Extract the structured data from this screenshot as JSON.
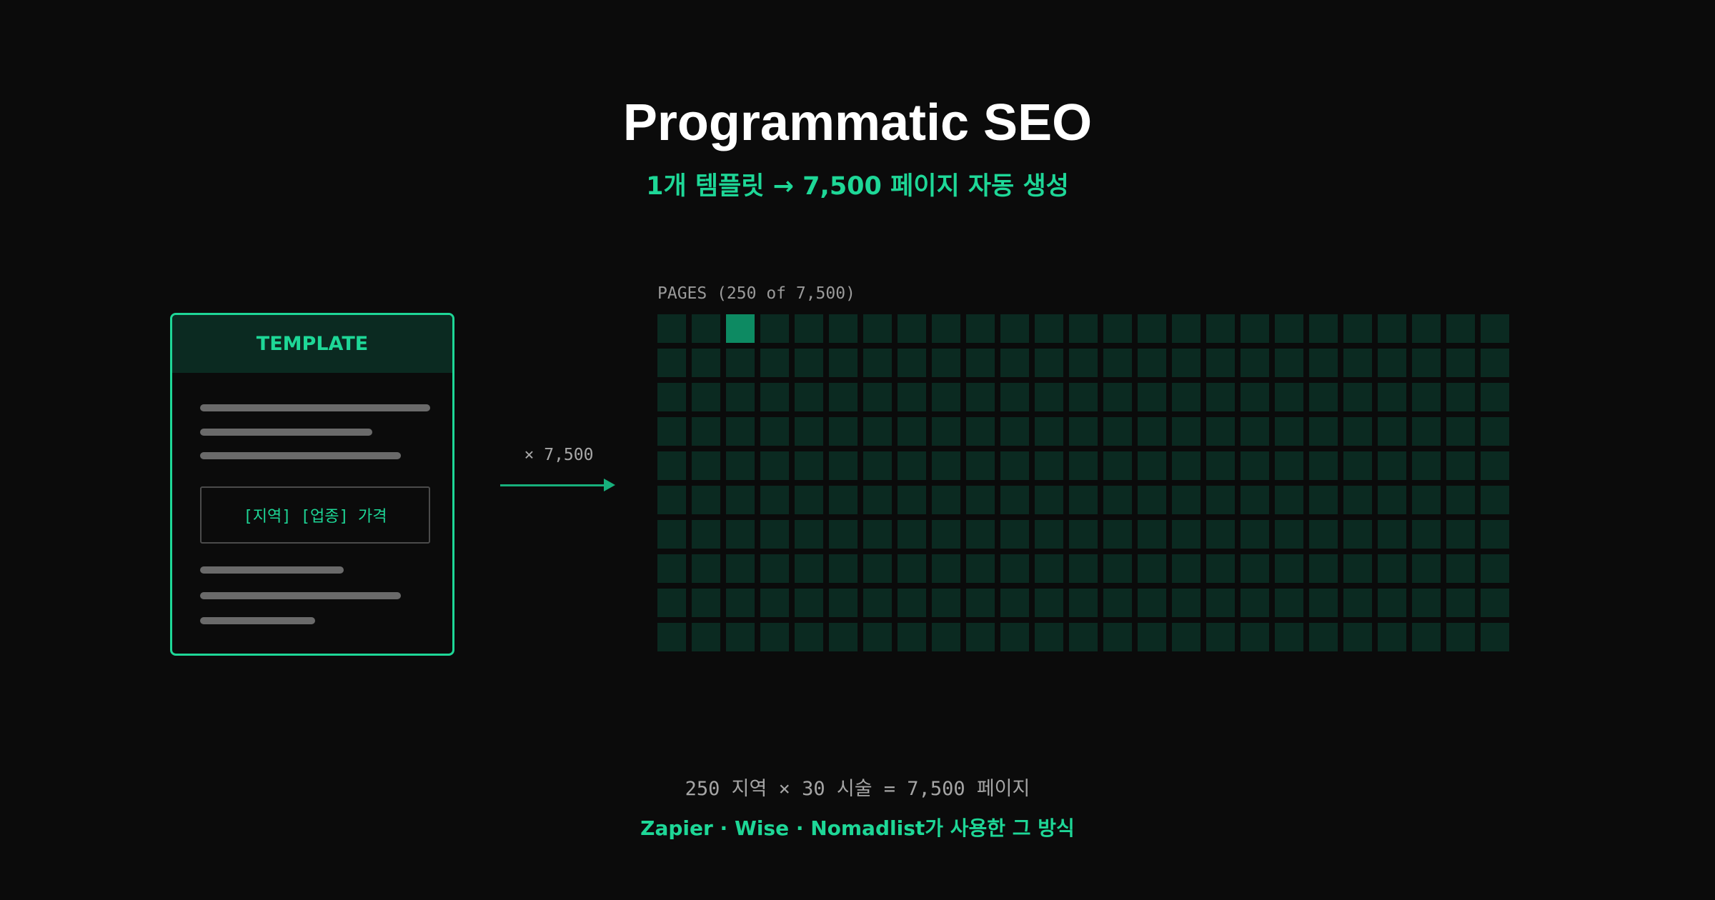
{
  "title": "Programmatic SEO",
  "subtitle": "1개 템플릿 → 7,500 페이지 자동 생성",
  "template": {
    "header": "TEMPLATE",
    "placeholder": "[지역] [업종] 가격"
  },
  "multiplier": "× 7,500",
  "pages": {
    "label": "PAGES (250 of 7,500)",
    "highlight_index": 2
  },
  "formula": "250 지역 × 30 시술 = 7,500 페이지",
  "footnote": "Zapier · Wise · Nomadlist가 사용한 그 방식",
  "colors": {
    "accent": "#1ed797",
    "cell": "#0b2a21",
    "cell_highlight": "#0d8a62",
    "background": "#0b0b0b"
  }
}
